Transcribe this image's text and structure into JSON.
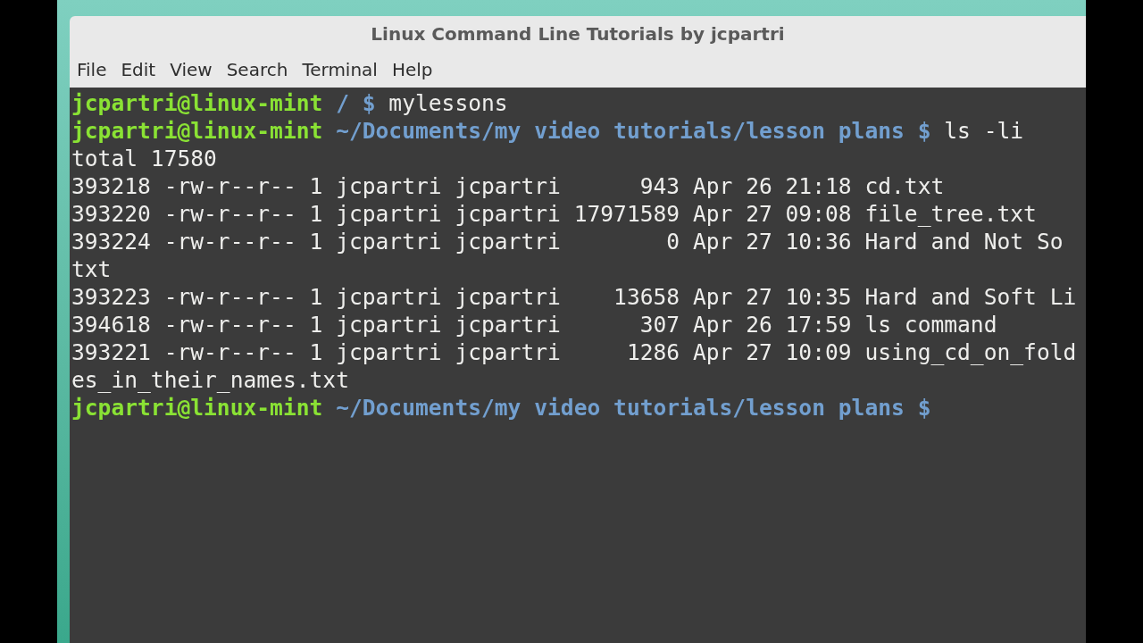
{
  "window": {
    "title": "Linux Command Line Tutorials by jcpartri"
  },
  "menu": [
    "File",
    "Edit",
    "View",
    "Search",
    "Terminal",
    "Help"
  ],
  "terminal": {
    "lines": [
      [
        {
          "kind": "user",
          "text": "jcpartri@linux-mint"
        },
        {
          "kind": "path",
          "text": " / $"
        },
        {
          "kind": "plain",
          "text": " mylessons"
        }
      ],
      [
        {
          "kind": "user",
          "text": "jcpartri@linux-mint"
        },
        {
          "kind": "path",
          "text": " ~/Documents/my video tutorials/lesson plans $"
        },
        {
          "kind": "plain",
          "text": " ls -li"
        }
      ],
      [
        {
          "kind": "plain",
          "text": "total 17580"
        }
      ],
      [
        {
          "kind": "plain",
          "text": "393218 -rw-r--r-- 1 jcpartri jcpartri      943 Apr 26 21:18 cd.txt"
        }
      ],
      [
        {
          "kind": "plain",
          "text": "393220 -rw-r--r-- 1 jcpartri jcpartri 17971589 Apr 27 09:08 file_tree.txt"
        }
      ],
      [
        {
          "kind": "plain",
          "text": "393224 -rw-r--r-- 1 jcpartri jcpartri        0 Apr 27 10:36 Hard and Not So"
        }
      ],
      [
        {
          "kind": "plain",
          "text": "txt"
        }
      ],
      [
        {
          "kind": "plain",
          "text": "393223 -rw-r--r-- 1 jcpartri jcpartri    13658 Apr 27 10:35 Hard and Soft Li"
        }
      ],
      [
        {
          "kind": "plain",
          "text": "394618 -rw-r--r-- 1 jcpartri jcpartri      307 Apr 26 17:59 ls command"
        }
      ],
      [
        {
          "kind": "plain",
          "text": "393221 -rw-r--r-- 1 jcpartri jcpartri     1286 Apr 27 10:09 using_cd_on_fold"
        }
      ],
      [
        {
          "kind": "plain",
          "text": "es_in_their_names.txt"
        }
      ],
      [
        {
          "kind": "user",
          "text": "jcpartri@linux-mint"
        },
        {
          "kind": "path",
          "text": " ~/Documents/my video tutorials/lesson plans $"
        }
      ]
    ]
  }
}
